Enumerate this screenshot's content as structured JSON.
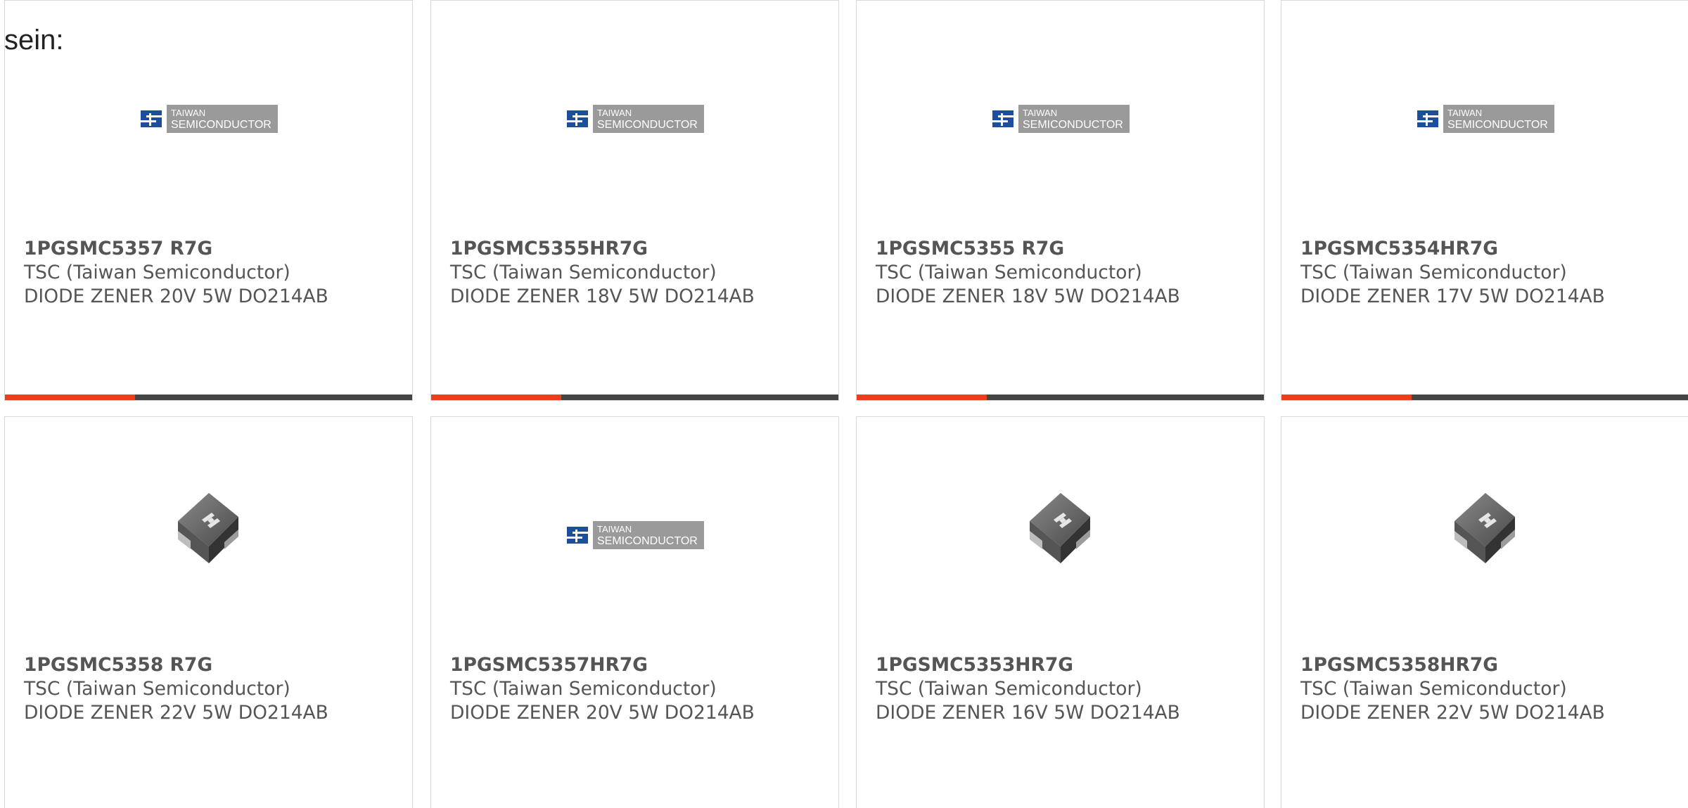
{
  "intro_text": "sein:",
  "theme": {
    "accent": "#e8401c",
    "bar_track": "#454545",
    "card_border": "#d9d9d9",
    "text": "#555555",
    "logo_blue": "#1d4e9c",
    "logo_grey": "#9a9a9a"
  },
  "products": [
    {
      "part_number": "1PGSMC5357 R7G",
      "manufacturer": "TSC (Taiwan Semiconductor)",
      "description": "DIODE ZENER 20V 5W DO214AB",
      "image": "tsc-logo",
      "progress": 0.32
    },
    {
      "part_number": "1PGSMC5355HR7G",
      "manufacturer": "TSC (Taiwan Semiconductor)",
      "description": "DIODE ZENER 18V 5W DO214AB",
      "image": "tsc-logo",
      "progress": 0.32
    },
    {
      "part_number": "1PGSMC5355 R7G",
      "manufacturer": "TSC (Taiwan Semiconductor)",
      "description": "DIODE ZENER 18V 5W DO214AB",
      "image": "tsc-logo",
      "progress": 0.32
    },
    {
      "part_number": "1PGSMC5354HR7G",
      "manufacturer": "TSC (Taiwan Semiconductor)",
      "description": "DIODE ZENER 17V 5W DO214AB",
      "image": "tsc-logo",
      "progress": 0.32
    },
    {
      "part_number": "1PGSMC5358 R7G",
      "manufacturer": "TSC (Taiwan Semiconductor)",
      "description": "DIODE ZENER 22V 5W DO214AB",
      "image": "diode-package"
    },
    {
      "part_number": "1PGSMC5357HR7G",
      "manufacturer": "TSC (Taiwan Semiconductor)",
      "description": "DIODE ZENER 20V 5W DO214AB",
      "image": "tsc-logo"
    },
    {
      "part_number": "1PGSMC5353HR7G",
      "manufacturer": "TSC (Taiwan Semiconductor)",
      "description": "DIODE ZENER 16V 5W DO214AB",
      "image": "diode-package"
    },
    {
      "part_number": "1PGSMC5358HR7G",
      "manufacturer": "TSC (Taiwan Semiconductor)",
      "description": "DIODE ZENER 22V 5W DO214AB",
      "image": "diode-package"
    }
  ],
  "logo": {
    "line1": "TAIWAN",
    "line2": "SEMICONDUCTOR"
  }
}
